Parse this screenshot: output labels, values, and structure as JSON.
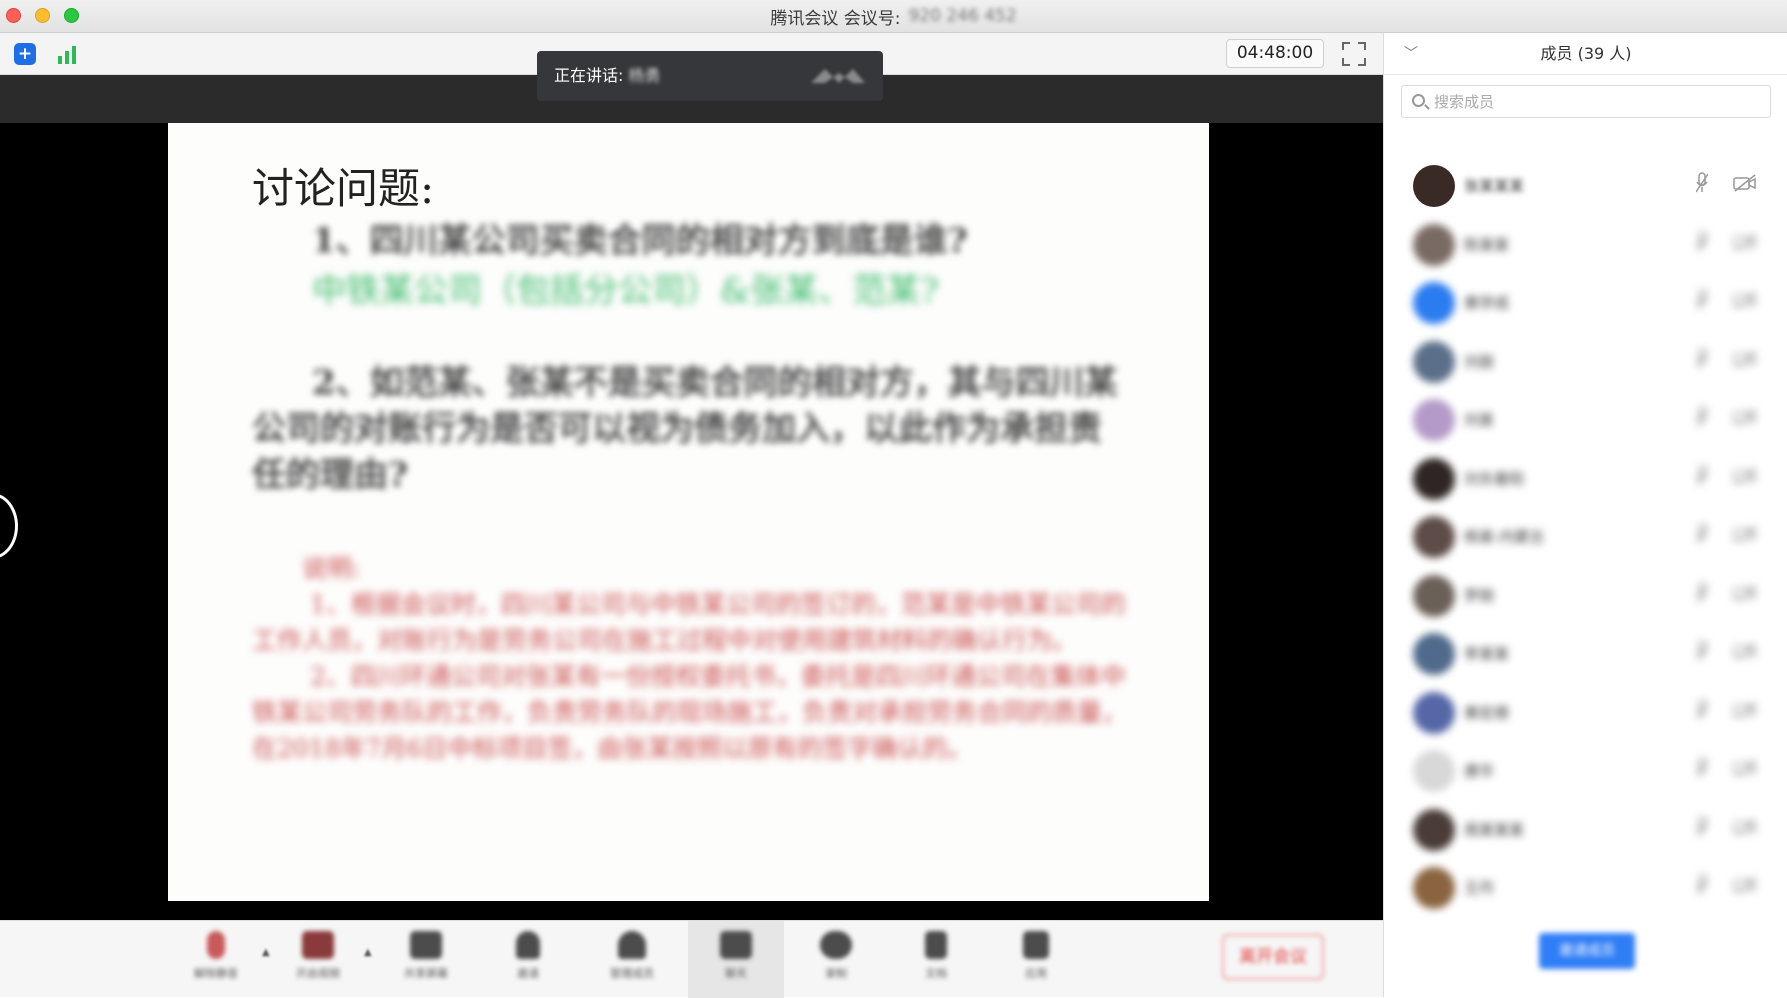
{
  "window": {
    "title": "腾讯会议 会议号:",
    "meeting_id": "920 246 452"
  },
  "toolbar_top": {
    "timer": "04:48:00",
    "icons": [
      "shield-icon",
      "signal-icon",
      "fullscreen-icon"
    ]
  },
  "speaker": {
    "label": "正在讲话:",
    "name": "杨勇"
  },
  "slide": {
    "title": "讨论问题:",
    "q1": "1、四川某公司买卖合同的相对方到底是谁?",
    "a1": "中铁某公司（包括分公司）&张某、范某?",
    "q2": "2、如范某、张某不是买卖合同的相对方，其与四川某公司的对账行为是否可以视为债务加入，以此作为承担责任的理由?",
    "note_title": "说明:",
    "note_1": "1、根据会议时，四川某公司与中铁某公司的签订的，范某是中铁某公司的工作人员，对账行为是劳务公司在施工过程中对使用建筑材料的确认行为。",
    "note_2": "2、四川环通公司对张某有一份授权委托书，委托是四川环通公司在集体中铁某公司劳务队的工作，负责劳务队的现场施工，负责对承担劳务合同的质量，在2018年7月6日中标项目签，由张某按照以原有的签字确认的。"
  },
  "bottom_toolbar": {
    "items": [
      {
        "label": "解除静音",
        "icon": "mic-muted-icon"
      },
      {
        "label": "开启视频",
        "icon": "camera-off-icon"
      },
      {
        "label": "共享屏幕",
        "icon": "screen-share-icon"
      },
      {
        "label": "邀请",
        "icon": "invite-icon"
      },
      {
        "label": "管理成员",
        "icon": "members-icon"
      },
      {
        "label": "聊天",
        "icon": "chat-icon"
      },
      {
        "label": "录制",
        "icon": "record-icon"
      },
      {
        "label": "文档",
        "icon": "document-icon"
      },
      {
        "label": "应用",
        "icon": "apps-icon"
      }
    ],
    "end_label": "离开会议"
  },
  "sidebar": {
    "title": "成员 (39 人)",
    "search_placeholder": "搜索成员",
    "invite_label": "邀请成员",
    "members": [
      {
        "name": "张某某某",
        "avatar_color": "#3a2a26"
      },
      {
        "name": "陈某某",
        "avatar_color": "#7a6a64"
      },
      {
        "name": "黄学成",
        "avatar_color": "#2b7cf0"
      },
      {
        "name": "刘丽",
        "avatar_color": "#5b6f8a"
      },
      {
        "name": "刘某",
        "avatar_color": "#b49ac8"
      },
      {
        "name": "刘东春阳",
        "avatar_color": "#2e2624"
      },
      {
        "name": "杨某-内蒙古",
        "avatar_color": "#5d4c48"
      },
      {
        "name": "罗刚",
        "avatar_color": "#6b6058"
      },
      {
        "name": "李某某",
        "avatar_color": "#4f6a8c"
      },
      {
        "name": "黄宏德",
        "avatar_color": "#5667a8"
      },
      {
        "name": "唐华",
        "avatar_color": "#d8d8d8"
      },
      {
        "name": "周某某某",
        "avatar_color": "#4a3c38"
      },
      {
        "name": "王丹",
        "avatar_color": "#8a6440"
      }
    ]
  },
  "colors": {
    "accent": "#2f7ef6",
    "end_meeting": "#e23c3c",
    "slide_green": "#3bbb6a",
    "slide_red": "#c9504f"
  }
}
